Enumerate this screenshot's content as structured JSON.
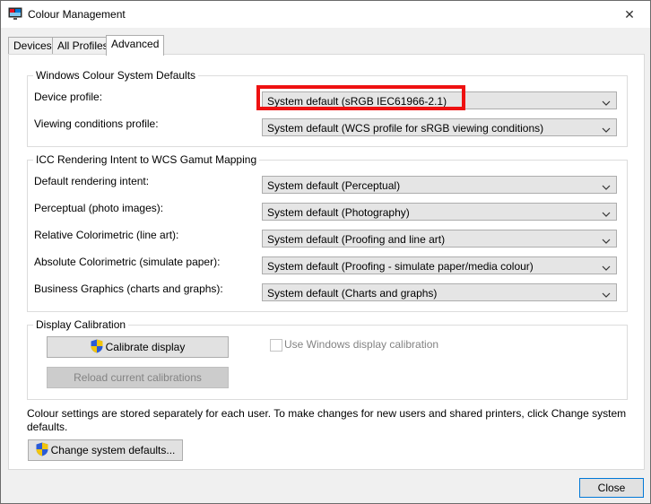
{
  "window": {
    "title": "Colour Management",
    "close_glyph": "✕"
  },
  "tabs": [
    {
      "label": "Devices",
      "active": false
    },
    {
      "label": "All Profiles",
      "active": false
    },
    {
      "label": "Advanced",
      "active": true
    }
  ],
  "wcs_defaults": {
    "title": "Windows Colour System Defaults",
    "device_profile": {
      "label": "Device profile:",
      "value": "System default (sRGB IEC61966-2.1)"
    },
    "viewing_conditions": {
      "label": "Viewing conditions profile:",
      "value": "System default (WCS profile for sRGB viewing conditions)"
    }
  },
  "icc_mapping": {
    "title": "ICC Rendering Intent to WCS Gamut Mapping",
    "rows": [
      {
        "label": "Default rendering intent:",
        "value": "System default (Perceptual)"
      },
      {
        "label": "Perceptual (photo images):",
        "value": "System default (Photography)"
      },
      {
        "label": "Relative Colorimetric (line art):",
        "value": "System default (Proofing and line art)"
      },
      {
        "label": "Absolute Colorimetric (simulate paper):",
        "value": "System default (Proofing - simulate paper/media colour)"
      },
      {
        "label": "Business Graphics (charts and graphs):",
        "value": "System default (Charts and graphs)"
      }
    ]
  },
  "calibration": {
    "title": "Display Calibration",
    "calibrate_button": "Calibrate display",
    "reload_button": "Reload current calibrations",
    "use_windows_calibration": "Use Windows display calibration"
  },
  "footer": {
    "note": "Colour settings are stored separately for each user. To make changes for new users and shared printers, click Change system defaults.",
    "change_defaults_button": "Change system defaults...",
    "close_button": "Close"
  },
  "colors": {
    "highlight": "#ee1111",
    "accent": "#0078d7"
  }
}
